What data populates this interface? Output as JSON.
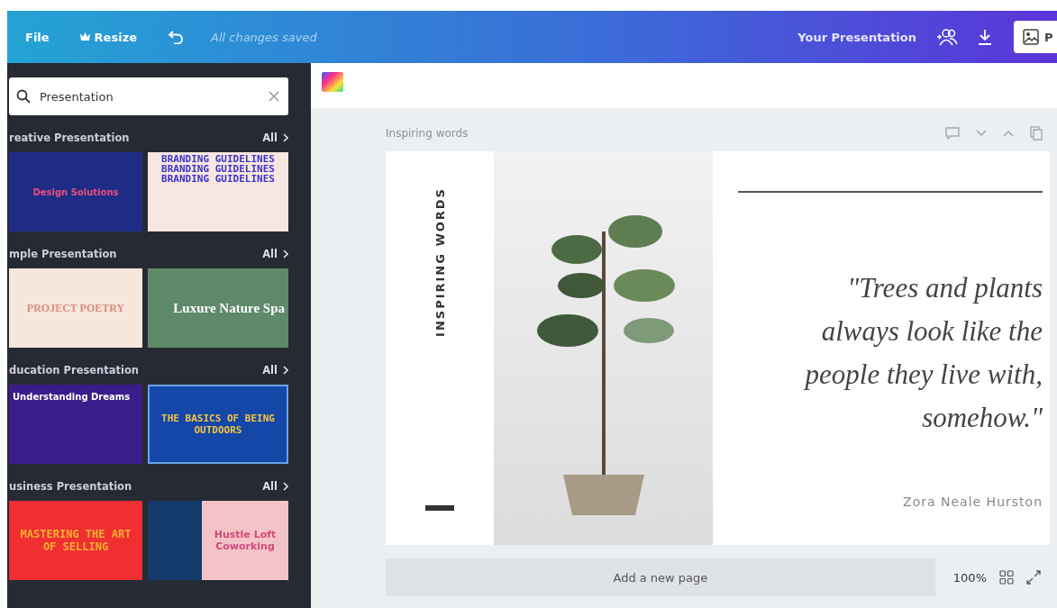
{
  "topbar": {
    "menu": [
      {
        "label": "File",
        "kind": "plain"
      },
      {
        "label": "Resize",
        "kind": "premium"
      }
    ],
    "status": "All changes saved",
    "title": "Your Presentation",
    "share_label": "P"
  },
  "sidebar": {
    "search": {
      "value": "Presentation"
    },
    "sections": [
      {
        "title": "reative Presentation",
        "link": "All",
        "thumbnails": [
          {
            "title": "Design Solutions"
          },
          {
            "title": "BRANDING GUIDELINES BRANDING GUIDELINES BRANDING GUIDELINES"
          }
        ]
      },
      {
        "title": "mple Presentation",
        "link": "All",
        "thumbnails": [
          {
            "title": "PROJECT POETRY"
          },
          {
            "title": "Luxure Nature Spa"
          }
        ]
      },
      {
        "title": "ducation Presentation",
        "link": "All",
        "thumbnails": [
          {
            "title": "Understanding Dreams"
          },
          {
            "title": "THE BASICS OF BEING OUTDOORS"
          }
        ]
      },
      {
        "title": "usiness Presentation",
        "link": "All",
        "thumbnails": [
          {
            "title": "MASTERING THE ART OF SELLING"
          },
          {
            "title": "Hustle Loft Coworking"
          }
        ]
      }
    ]
  },
  "page": {
    "label": "Inspiring words",
    "slide": {
      "side_title": "INSPIRING WORDS",
      "quote": "\"Trees and plants always look like the people they live with, somehow.\"",
      "author": "Zora Neale Hurston"
    }
  },
  "footer": {
    "add_page": "Add a new page",
    "zoom": "100%"
  }
}
